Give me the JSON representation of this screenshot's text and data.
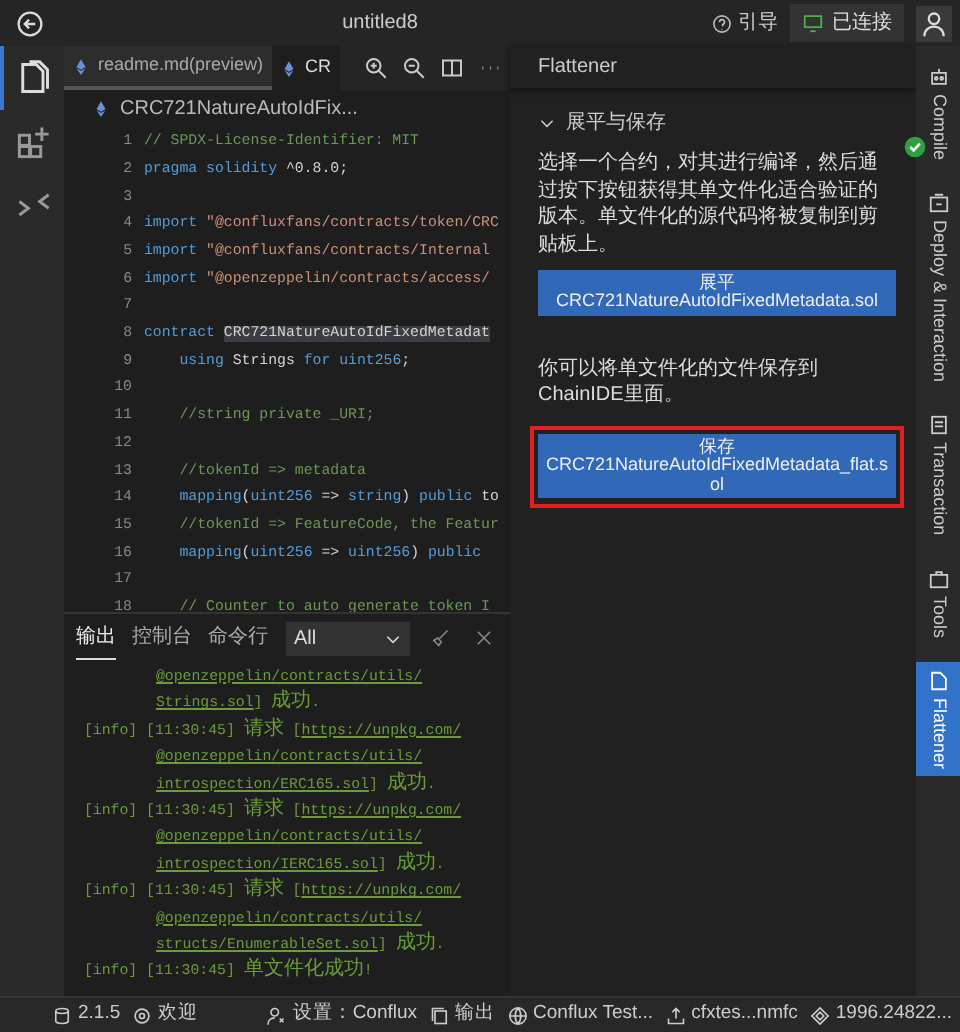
{
  "title_bar": {
    "title": "untitled8",
    "guide": "引导",
    "connection": "已连接"
  },
  "activity_bar": [
    {
      "kind": "files",
      "selected": true
    },
    {
      "kind": "extensions",
      "selected": false
    },
    {
      "kind": "git",
      "selected": false
    }
  ],
  "editor": {
    "tabs": [
      {
        "label": "readme.md(preview)",
        "selected": false
      },
      {
        "label": "CR",
        "selected": true
      }
    ],
    "breadcrumb": "CRC721NatureAutoIdFix...",
    "lines": [
      {
        "number": "1",
        "segments": [
          {
            "kind": "comment",
            "text": "// SPDX-License-Identifier: MIT"
          }
        ]
      },
      {
        "number": "2",
        "segments": [
          {
            "kind": "keyword",
            "text": "pragma solidity"
          },
          {
            "kind": "plain",
            "text": " ^0.8.0;"
          }
        ]
      },
      {
        "number": "3"
      },
      {
        "number": "4",
        "segments": [
          {
            "kind": "keyword",
            "text": "import"
          },
          {
            "kind": "string",
            "text": " \"@confluxfans/contracts/token/CRC"
          }
        ]
      },
      {
        "number": "5",
        "segments": [
          {
            "kind": "keyword",
            "text": "import"
          },
          {
            "kind": "string",
            "text": " \"@confluxfans/contracts/Internal"
          }
        ]
      },
      {
        "number": "6",
        "segments": [
          {
            "kind": "keyword",
            "text": "import"
          },
          {
            "kind": "string",
            "text": " \"@openzeppelin/contracts/access/"
          }
        ]
      },
      {
        "number": "7"
      },
      {
        "number": "8",
        "segments": [
          {
            "kind": "keyword",
            "text": "contract "
          },
          {
            "kind": "highlight",
            "text": "CRC721NatureAutoIdFixedMetadat"
          }
        ]
      },
      {
        "number": "9",
        "segments": [
          {
            "kind": "keyword",
            "text": "    using"
          },
          {
            "kind": "plain",
            "text": " Strings "
          },
          {
            "kind": "keyword",
            "text": "for uint256"
          },
          {
            "kind": "plain",
            "text": ";"
          }
        ]
      },
      {
        "number": "10"
      },
      {
        "number": "11",
        "segments": [
          {
            "kind": "comment",
            "text": "    //string private _URI;"
          }
        ]
      },
      {
        "number": "12"
      },
      {
        "number": "13",
        "segments": [
          {
            "kind": "comment",
            "text": "    //tokenId => metadata"
          }
        ]
      },
      {
        "number": "14",
        "segments": [
          {
            "kind": "keyword",
            "text": "    mapping"
          },
          {
            "kind": "plain",
            "text": "("
          },
          {
            "kind": "keyword",
            "text": "uint256"
          },
          {
            "kind": "plain",
            "text": " => "
          },
          {
            "kind": "keyword",
            "text": "string"
          },
          {
            "kind": "plain",
            "text": ") "
          },
          {
            "kind": "keyword",
            "text": "public"
          },
          {
            "kind": "plain",
            "text": " to"
          }
        ]
      },
      {
        "number": "15",
        "segments": [
          {
            "kind": "comment",
            "text": "    //tokenId => FeatureCode, the Featur"
          }
        ]
      },
      {
        "number": "16",
        "segments": [
          {
            "kind": "keyword",
            "text": "    mapping"
          },
          {
            "kind": "plain",
            "text": "("
          },
          {
            "kind": "keyword",
            "text": "uint256"
          },
          {
            "kind": "plain",
            "text": " => "
          },
          {
            "kind": "keyword",
            "text": "uint256"
          },
          {
            "kind": "plain",
            "text": ") "
          },
          {
            "kind": "keyword",
            "text": "public"
          }
        ]
      },
      {
        "number": "17"
      },
      {
        "number": "18",
        "segments": [
          {
            "kind": "comment",
            "text": "    // Counter to auto generate token I"
          }
        ]
      }
    ]
  },
  "output_panel": {
    "tabs": [
      {
        "label": "输出",
        "selected": true
      },
      {
        "label": "控制台",
        "selected": false
      },
      {
        "label": "命令行",
        "selected": false
      }
    ],
    "filter": "All",
    "log": [
      {
        "link_lines": [
          "@openzeppelin/contracts/utils/",
          "Strings.sol"
        ],
        "suffix": "] 成功."
      },
      {
        "prefix": "[info] [11:30:45] 请求 [",
        "link_lines": [
          "https://unpkg.com/",
          "@openzeppelin/contracts/utils/",
          "introspection/ERC165.sol"
        ],
        "suffix": "] 成功."
      },
      {
        "prefix": "[info] [11:30:45] 请求 [",
        "link_lines": [
          "https://unpkg.com/",
          "@openzeppelin/contracts/utils/",
          "introspection/IERC165.sol"
        ],
        "suffix": "] 成功."
      },
      {
        "prefix": "[info] [11:30:45] 请求 [",
        "link_lines": [
          "https://unpkg.com/",
          "@openzeppelin/contracts/utils/",
          "structs/EnumerableSet.sol"
        ],
        "suffix": "] 成功."
      },
      {
        "prefix": "[info] [11:30:45] 单文件化成功!"
      }
    ]
  },
  "flattener": {
    "title": "Flattener",
    "section": {
      "title": "展平与保存",
      "expanded": true
    },
    "description": "选择一个合约，对其进行编译，然后通过按下按钮获得其单文件化适合验证的版本。单文件化的源代码将被复制到剪贴板上。",
    "flatten_button": {
      "label": "展平",
      "file": "CRC721NatureAutoIdFixedMetadata.sol"
    },
    "save_hint": "你可以将单文件化的文件保存到ChainIDE里面。",
    "save_button": {
      "label": "保存",
      "file": "CRC721NatureAutoIdFixedMetadata_flat.sol",
      "highlighted": true
    }
  },
  "right_bar": [
    {
      "kind": "compile",
      "label": "Compile",
      "selected": false,
      "checked": true
    },
    {
      "kind": "deploy",
      "label": "Deploy & Interaction",
      "selected": false,
      "checked": false
    },
    {
      "kind": "transaction",
      "label": "Transaction",
      "selected": false,
      "checked": false
    },
    {
      "kind": "tools",
      "label": "Tools",
      "selected": false,
      "checked": false
    },
    {
      "kind": "flattener",
      "label": "Flattener",
      "selected": true,
      "checked": false
    }
  ],
  "status_bar": [
    {
      "kind": "version",
      "text": "2.1.5"
    },
    {
      "kind": "welcome",
      "text": "欢迎"
    },
    {
      "kind": "settings",
      "text": "设置：Conflux"
    },
    {
      "kind": "output",
      "text": "输出"
    },
    {
      "kind": "network",
      "text": "Conflux Test..."
    },
    {
      "kind": "account",
      "text": "cfxtes...nmfc"
    },
    {
      "kind": "balance",
      "text": "1996.24822..."
    }
  ]
}
